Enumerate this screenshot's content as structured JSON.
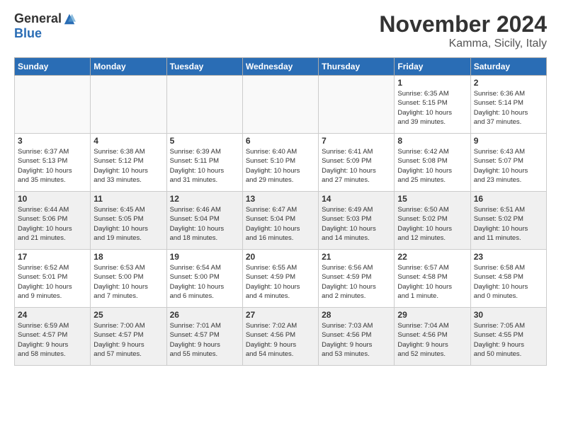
{
  "logo": {
    "general": "General",
    "blue": "Blue",
    "tagline": ""
  },
  "header": {
    "title": "November 2024",
    "subtitle": "Kamma, Sicily, Italy"
  },
  "weekdays": [
    "Sunday",
    "Monday",
    "Tuesday",
    "Wednesday",
    "Thursday",
    "Friday",
    "Saturday"
  ],
  "weeks": [
    [
      {
        "day": "",
        "info": ""
      },
      {
        "day": "",
        "info": ""
      },
      {
        "day": "",
        "info": ""
      },
      {
        "day": "",
        "info": ""
      },
      {
        "day": "",
        "info": ""
      },
      {
        "day": "1",
        "info": "Sunrise: 6:35 AM\nSunset: 5:15 PM\nDaylight: 10 hours\nand 39 minutes."
      },
      {
        "day": "2",
        "info": "Sunrise: 6:36 AM\nSunset: 5:14 PM\nDaylight: 10 hours\nand 37 minutes."
      }
    ],
    [
      {
        "day": "3",
        "info": "Sunrise: 6:37 AM\nSunset: 5:13 PM\nDaylight: 10 hours\nand 35 minutes."
      },
      {
        "day": "4",
        "info": "Sunrise: 6:38 AM\nSunset: 5:12 PM\nDaylight: 10 hours\nand 33 minutes."
      },
      {
        "day": "5",
        "info": "Sunrise: 6:39 AM\nSunset: 5:11 PM\nDaylight: 10 hours\nand 31 minutes."
      },
      {
        "day": "6",
        "info": "Sunrise: 6:40 AM\nSunset: 5:10 PM\nDaylight: 10 hours\nand 29 minutes."
      },
      {
        "day": "7",
        "info": "Sunrise: 6:41 AM\nSunset: 5:09 PM\nDaylight: 10 hours\nand 27 minutes."
      },
      {
        "day": "8",
        "info": "Sunrise: 6:42 AM\nSunset: 5:08 PM\nDaylight: 10 hours\nand 25 minutes."
      },
      {
        "day": "9",
        "info": "Sunrise: 6:43 AM\nSunset: 5:07 PM\nDaylight: 10 hours\nand 23 minutes."
      }
    ],
    [
      {
        "day": "10",
        "info": "Sunrise: 6:44 AM\nSunset: 5:06 PM\nDaylight: 10 hours\nand 21 minutes."
      },
      {
        "day": "11",
        "info": "Sunrise: 6:45 AM\nSunset: 5:05 PM\nDaylight: 10 hours\nand 19 minutes."
      },
      {
        "day": "12",
        "info": "Sunrise: 6:46 AM\nSunset: 5:04 PM\nDaylight: 10 hours\nand 18 minutes."
      },
      {
        "day": "13",
        "info": "Sunrise: 6:47 AM\nSunset: 5:04 PM\nDaylight: 10 hours\nand 16 minutes."
      },
      {
        "day": "14",
        "info": "Sunrise: 6:49 AM\nSunset: 5:03 PM\nDaylight: 10 hours\nand 14 minutes."
      },
      {
        "day": "15",
        "info": "Sunrise: 6:50 AM\nSunset: 5:02 PM\nDaylight: 10 hours\nand 12 minutes."
      },
      {
        "day": "16",
        "info": "Sunrise: 6:51 AM\nSunset: 5:02 PM\nDaylight: 10 hours\nand 11 minutes."
      }
    ],
    [
      {
        "day": "17",
        "info": "Sunrise: 6:52 AM\nSunset: 5:01 PM\nDaylight: 10 hours\nand 9 minutes."
      },
      {
        "day": "18",
        "info": "Sunrise: 6:53 AM\nSunset: 5:00 PM\nDaylight: 10 hours\nand 7 minutes."
      },
      {
        "day": "19",
        "info": "Sunrise: 6:54 AM\nSunset: 5:00 PM\nDaylight: 10 hours\nand 6 minutes."
      },
      {
        "day": "20",
        "info": "Sunrise: 6:55 AM\nSunset: 4:59 PM\nDaylight: 10 hours\nand 4 minutes."
      },
      {
        "day": "21",
        "info": "Sunrise: 6:56 AM\nSunset: 4:59 PM\nDaylight: 10 hours\nand 2 minutes."
      },
      {
        "day": "22",
        "info": "Sunrise: 6:57 AM\nSunset: 4:58 PM\nDaylight: 10 hours\nand 1 minute."
      },
      {
        "day": "23",
        "info": "Sunrise: 6:58 AM\nSunset: 4:58 PM\nDaylight: 10 hours\nand 0 minutes."
      }
    ],
    [
      {
        "day": "24",
        "info": "Sunrise: 6:59 AM\nSunset: 4:57 PM\nDaylight: 9 hours\nand 58 minutes."
      },
      {
        "day": "25",
        "info": "Sunrise: 7:00 AM\nSunset: 4:57 PM\nDaylight: 9 hours\nand 57 minutes."
      },
      {
        "day": "26",
        "info": "Sunrise: 7:01 AM\nSunset: 4:57 PM\nDaylight: 9 hours\nand 55 minutes."
      },
      {
        "day": "27",
        "info": "Sunrise: 7:02 AM\nSunset: 4:56 PM\nDaylight: 9 hours\nand 54 minutes."
      },
      {
        "day": "28",
        "info": "Sunrise: 7:03 AM\nSunset: 4:56 PM\nDaylight: 9 hours\nand 53 minutes."
      },
      {
        "day": "29",
        "info": "Sunrise: 7:04 AM\nSunset: 4:56 PM\nDaylight: 9 hours\nand 52 minutes."
      },
      {
        "day": "30",
        "info": "Sunrise: 7:05 AM\nSunset: 4:55 PM\nDaylight: 9 hours\nand 50 minutes."
      }
    ]
  ]
}
